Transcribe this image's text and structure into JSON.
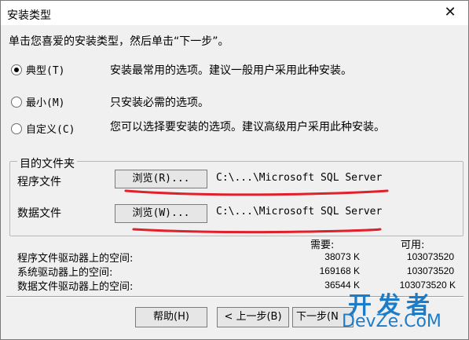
{
  "window": {
    "title": "安装类型",
    "close_glyph": "✕"
  },
  "instruction": "单击您喜爱的安装类型，然后单击“下一步”。",
  "options": [
    {
      "label": "典型(T)",
      "description": "安装最常用的选项。建议一般用户采用此种安装。",
      "selected": true
    },
    {
      "label": "最小(M)",
      "description": "只安装必需的选项。",
      "selected": false
    },
    {
      "label": "自定义(C)",
      "description": "您可以选择要安装的选项。建议高级用户采用此种安装。",
      "selected": false
    }
  ],
  "destination": {
    "group_label": "目的文件夹",
    "program_label": "程序文件",
    "program_button": "浏览(R)...",
    "program_path": "C:\\...\\Microsoft SQL Server",
    "data_label": "数据文件",
    "data_button": "浏览(W)...",
    "data_path": "C:\\...\\Microsoft SQL Server"
  },
  "space": {
    "required_header": "需要:",
    "available_header": "可用:",
    "rows": [
      {
        "label": "程序文件驱动器上的空间:",
        "required": "38073 K",
        "available": "103073520"
      },
      {
        "label": "系统驱动器上的空间:",
        "required": "169168 K",
        "available": "103073520"
      },
      {
        "label": "数据文件驱动器上的空间:",
        "required": "36544 K",
        "available": "103073520 K"
      }
    ]
  },
  "buttons": {
    "help": "帮助(H)",
    "back": "< 上一步(B)",
    "next": "下一步(N"
  },
  "watermark": {
    "line1": "开发者",
    "line2": "DevZe.CoM",
    "color": "#1c7cc8"
  },
  "annotation_color": "#e0202a"
}
